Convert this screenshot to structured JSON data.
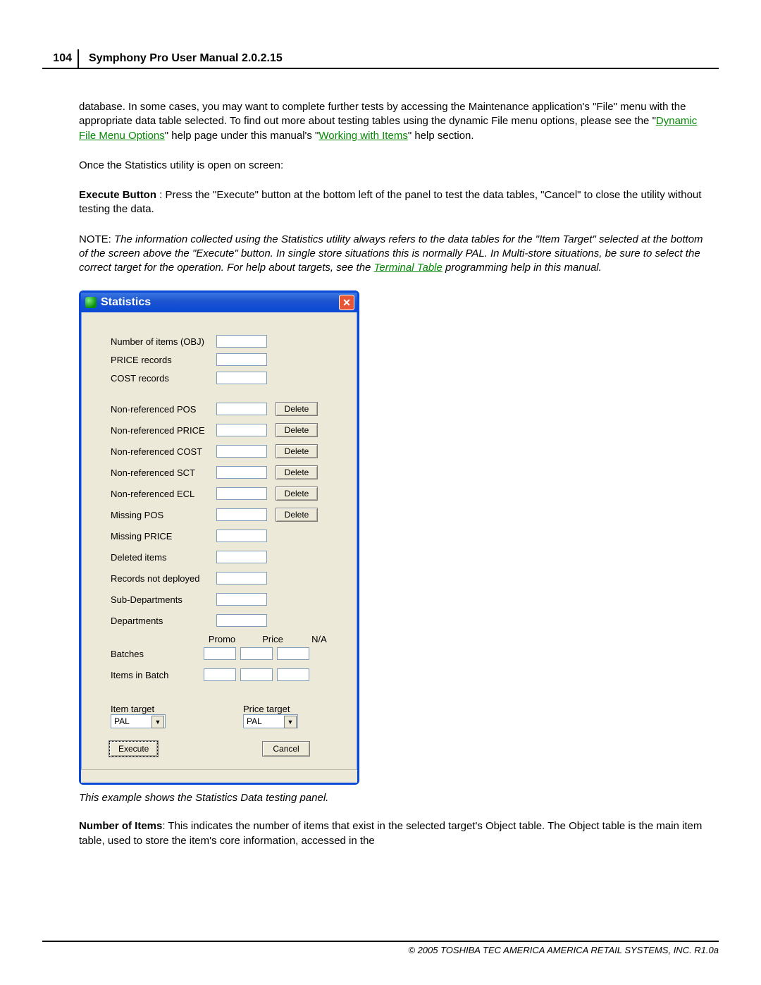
{
  "header": {
    "page_number": "104",
    "title": "Symphony Pro User Manual  2.0.2.15"
  },
  "body": {
    "p1_a": "database. In some cases, you may want to complete further tests by accessing the Maintenance application's \"File\" menu with the appropriate data table selected. To find out more about testing tables using the dynamic File menu options, please see the \"",
    "link1": "Dynamic File Menu Options",
    "p1_b": "\" help page under this manual's \"",
    "link2": "Working with Items",
    "p1_c": "\" help section.",
    "p2": " Once the Statistics utility is open on screen:",
    "p3_bold": "Execute Button",
    "p3_rest": " : Press the \"Execute\" button at the bottom left of the panel to test the data tables, \"Cancel\" to close the utility without testing the data.",
    "note_label": "NOTE: ",
    "note_a": "The information collected using the Statistics utility always refers to the data tables for the \"Item Target\" selected at the bottom of the screen above the \"Execute\" button. In single store situations this is normally PAL. In Multi-store situations, be sure to select the correct target for the operation. For help about targets, see the  ",
    "note_link": "Terminal Table",
    "note_b": "  programming help in this manual.",
    "caption": "This example shows the Statistics Data testing panel.",
    "p_after_bold": "Number of Items",
    "p_after_rest": ": This indicates the number of items that exist in the selected target's Object table. The Object table is the main item table, used to store the item's core information, accessed in the"
  },
  "dlg": {
    "title": "Statistics",
    "close_glyph": "✕",
    "labels": {
      "num_items": "Number of items (OBJ)",
      "price_records": "PRICE records",
      "cost_records": "COST records",
      "nr_pos": "Non-referenced POS",
      "nr_price": "Non-referenced PRICE",
      "nr_cost": "Non-referenced COST",
      "nr_sct": "Non-referenced SCT",
      "nr_ecl": "Non-referenced ECL",
      "miss_pos": "Missing POS",
      "miss_price": "Missing PRICE",
      "del_items": "Deleted items",
      "not_deployed": "Records not deployed",
      "sub_dept": "Sub-Departments",
      "dept": "Departments",
      "batches": "Batches",
      "items_in_batch": "Items in Batch"
    },
    "cols": {
      "promo": "Promo",
      "price": "Price",
      "na": "N/A"
    },
    "delete_btn": "Delete",
    "item_target_label": "Item target",
    "price_target_label": "Price target",
    "item_target_value": "PAL",
    "price_target_value": "PAL",
    "execute": "Execute",
    "cancel": "Cancel"
  },
  "footer": "© 2005 TOSHIBA TEC AMERICA AMERICA RETAIL SYSTEMS, INC.   R1.0a"
}
